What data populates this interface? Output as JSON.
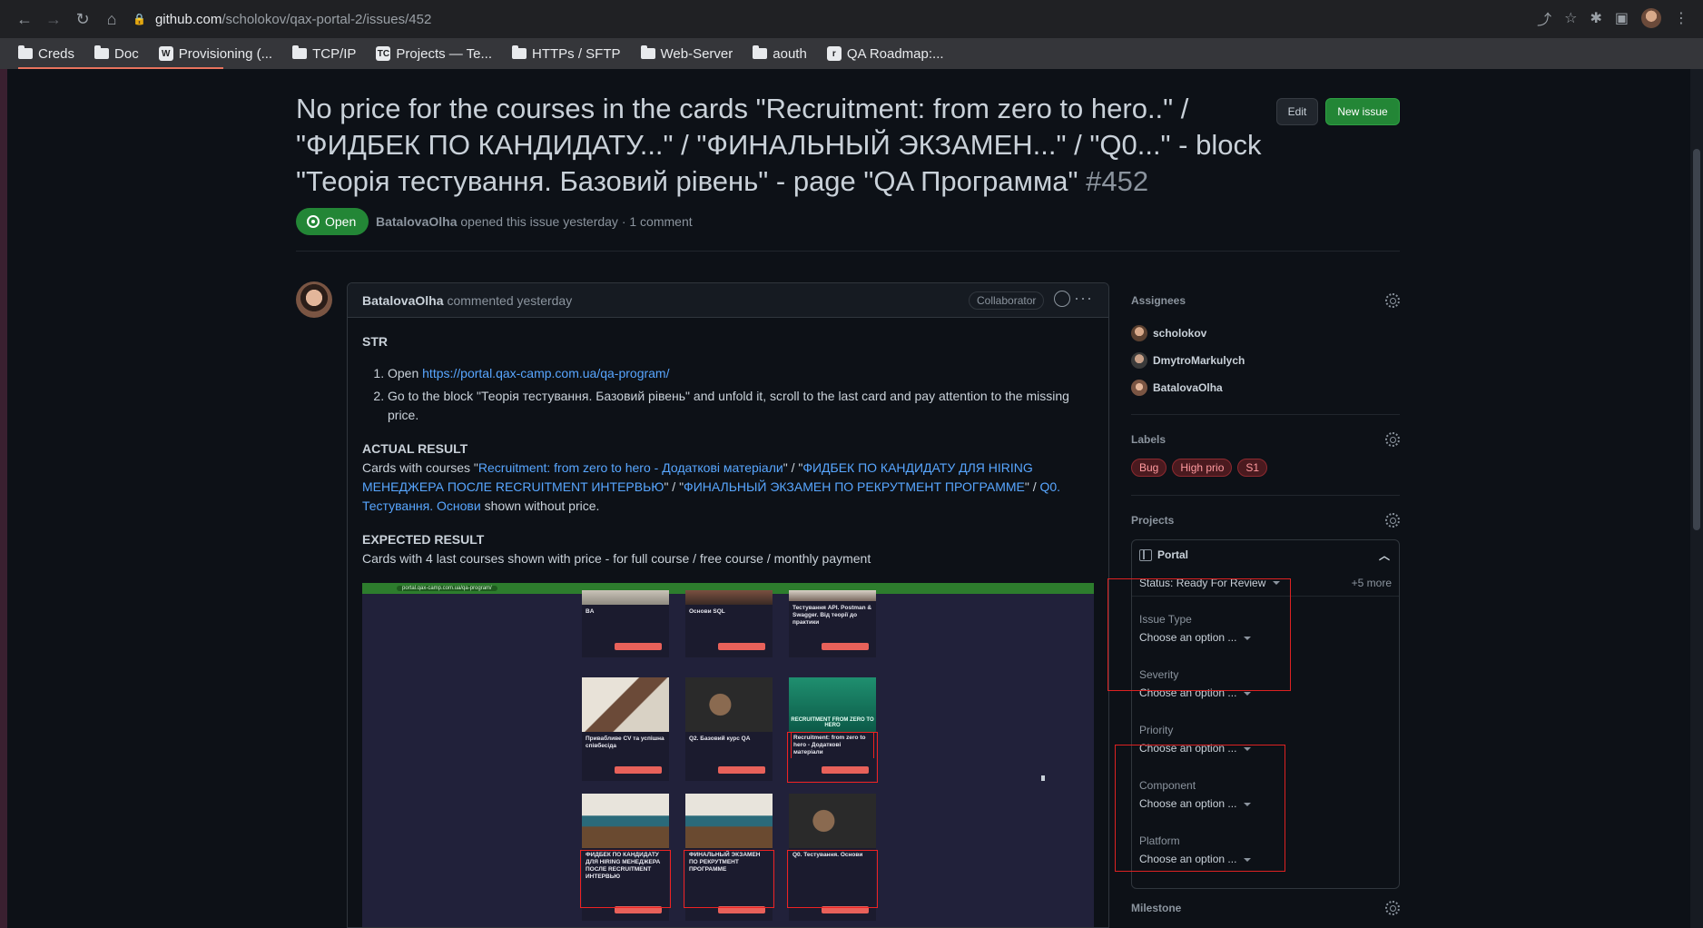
{
  "browser": {
    "url_host": "github.com",
    "url_path": "/scholokov/qax-portal-2/issues/452",
    "bookmarks": [
      "Creds",
      "Doc",
      "Provisioning (...",
      "TCP/IP",
      "Projects — Te...",
      "HTTPs / SFTP",
      "Web-Server",
      "aouth",
      "QA Roadmap:..."
    ]
  },
  "issue": {
    "title": "No price for the courses in the cards \"Recruitment: from zero to hero..\" / \"ФИДБЕК ПО КАНДИДАТУ...\" / \"ФИНАЛЬНЫЙ ЭКЗАМЕН...\" / \"Q0...\" - block \"Теорія тестування. Базовий рівень\" - page \"QA Программа\"",
    "number": "#452",
    "state": "Open",
    "author": "BatalovaOlha",
    "meta_rest": "opened this issue yesterday · 1 comment",
    "edit_label": "Edit",
    "new_issue_label": "New issue"
  },
  "comment": {
    "author": "BatalovaOlha",
    "when": "commented yesterday",
    "badge": "Collaborator",
    "str_heading": "STR",
    "step1_prefix": "Open ",
    "step1_link": "https://portal.qax-camp.com.ua/qa-program/",
    "step2": "Go to the block \"Теорія тестування. Базовий рівень\" and unfold it, scroll to the last card and pay attention to the missing price.",
    "actual_heading": "ACTUAL RESULT",
    "actual_prefix": "Cards with courses \"",
    "actual_link1": "Recruitment: from zero to hero - Додаткові матеріали",
    "actual_sep1": "\" / \"",
    "actual_link2": "ФИДБЕК ПО КАНДИДАТУ ДЛЯ HIRING МЕНЕДЖЕРА ПОСЛЕ RECRUITMENT ИНТЕРВЬЮ",
    "actual_sep2": "\" / \"",
    "actual_link3": "ФИНАЛЬНЫЙ ЭКЗАМЕН ПО РЕКРУТМЕНТ ПРОГРАММЕ",
    "actual_sep3": "\" / ",
    "actual_link4": "Q0. Тестування. Основи",
    "actual_suffix": " shown without price.",
    "expected_heading": "EXPECTED RESULT",
    "expected_text": "Cards with 4 last courses shown with price - for full course / free course / monthly payment",
    "screenshot": {
      "url": "portal.qax-camp.com.ua/qa-program/",
      "cards": [
        "BA",
        "Основи SQL",
        "Тестування API. Postman & Swagger. Від теорії до практики",
        "Привабливе CV та успішна співбесіда",
        "Q2. Базовий курс QA",
        "Recruitment: from zero to hero - Додаткові матеріали",
        "ФИДБЕК ПО КАНДИДАТУ ДЛЯ HIRING МЕНЕДЖЕРА ПОСЛЕ RECRUITMENT ИНТЕРВЬЮ",
        "ФИНАЛЬНЫЙ ЭКЗАМЕН ПО РЕКРУТМЕНТ ПРОГРАММЕ",
        "Q0. Тестування. Основи"
      ],
      "hero_text": "RECRUITMENT FROM ZERO TO HERO"
    }
  },
  "sidebar": {
    "assignees_title": "Assignees",
    "assignees": [
      "scholokov",
      "DmytroMarkulych",
      "BatalovaOlha"
    ],
    "labels_title": "Labels",
    "labels": [
      "Bug",
      "High prio",
      "S1"
    ],
    "projects_title": "Projects",
    "project_name": "Portal",
    "project_status": "Status: Ready For Review",
    "project_more": "+5 more",
    "fields": [
      {
        "label": "Issue Type",
        "value": "Choose an option ..."
      },
      {
        "label": "Severity",
        "value": "Choose an option ..."
      },
      {
        "label": "Priority",
        "value": "Choose an option ..."
      },
      {
        "label": "Component",
        "value": "Choose an option ..."
      },
      {
        "label": "Platform",
        "value": "Choose an option ..."
      }
    ],
    "milestone_title": "Milestone"
  },
  "colors": {
    "open_green": "#238636",
    "link": "#58a6ff",
    "highlight_red": "#dd2222"
  }
}
